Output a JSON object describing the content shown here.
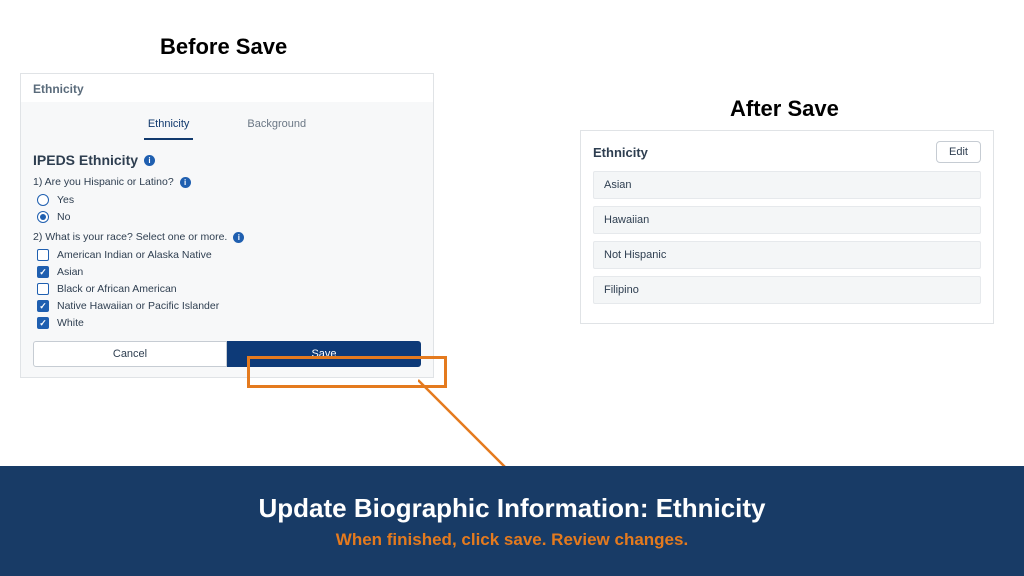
{
  "headings": {
    "before": "Before Save",
    "after": "After Save"
  },
  "left": {
    "panelTitle": "Ethnicity",
    "tabs": {
      "ethnicity": "Ethnicity",
      "background": "Background"
    },
    "sectionTitle": "IPEDS Ethnicity",
    "q1": "1) Are you Hispanic or Latino?",
    "q1opts": {
      "yes": "Yes",
      "no": "No"
    },
    "q2": "2) What is your race? Select one or more.",
    "races": {
      "amind": "American Indian or Alaska Native",
      "asian": "Asian",
      "black": "Black or African American",
      "nhpi": "Native Hawaiian or Pacific Islander",
      "white": "White"
    },
    "buttons": {
      "cancel": "Cancel",
      "save": "Save"
    }
  },
  "right": {
    "title": "Ethnicity",
    "edit": "Edit",
    "values": [
      "Asian",
      "Hawaiian",
      "Not Hispanic",
      "Filipino"
    ]
  },
  "banner": {
    "title": "Update Biographic Information: Ethnicity",
    "sub": "When finished, click save. Review changes."
  }
}
